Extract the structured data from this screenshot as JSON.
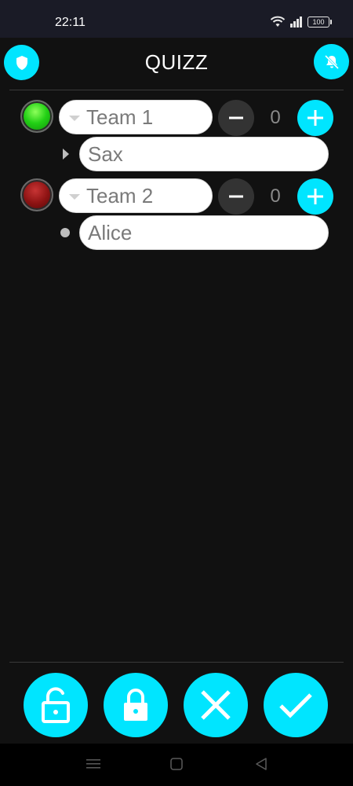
{
  "status_bar": {
    "time": "22:11",
    "battery": "100"
  },
  "header": {
    "title": "QUIZZ",
    "left_icon": "shield-icon",
    "right_icon": "notifications-off-icon"
  },
  "teams": [
    {
      "name": "Team 1",
      "score": "0",
      "led_color": "#22d015",
      "player": "Sax",
      "player_marker": "expand-arrow"
    },
    {
      "name": "Team 2",
      "score": "0",
      "led_color": "#8e1313",
      "player": "Alice",
      "player_marker": "bullet-dot"
    }
  ],
  "toolbar": {
    "icons": [
      "unlock-icon",
      "lock-icon",
      "close-icon",
      "check-icon"
    ]
  },
  "colors": {
    "accent": "#00e5ff",
    "background": "#111111",
    "minus_button": "#333333"
  },
  "nav": {
    "icons": [
      "menu-icon",
      "home-icon",
      "back-icon"
    ]
  }
}
